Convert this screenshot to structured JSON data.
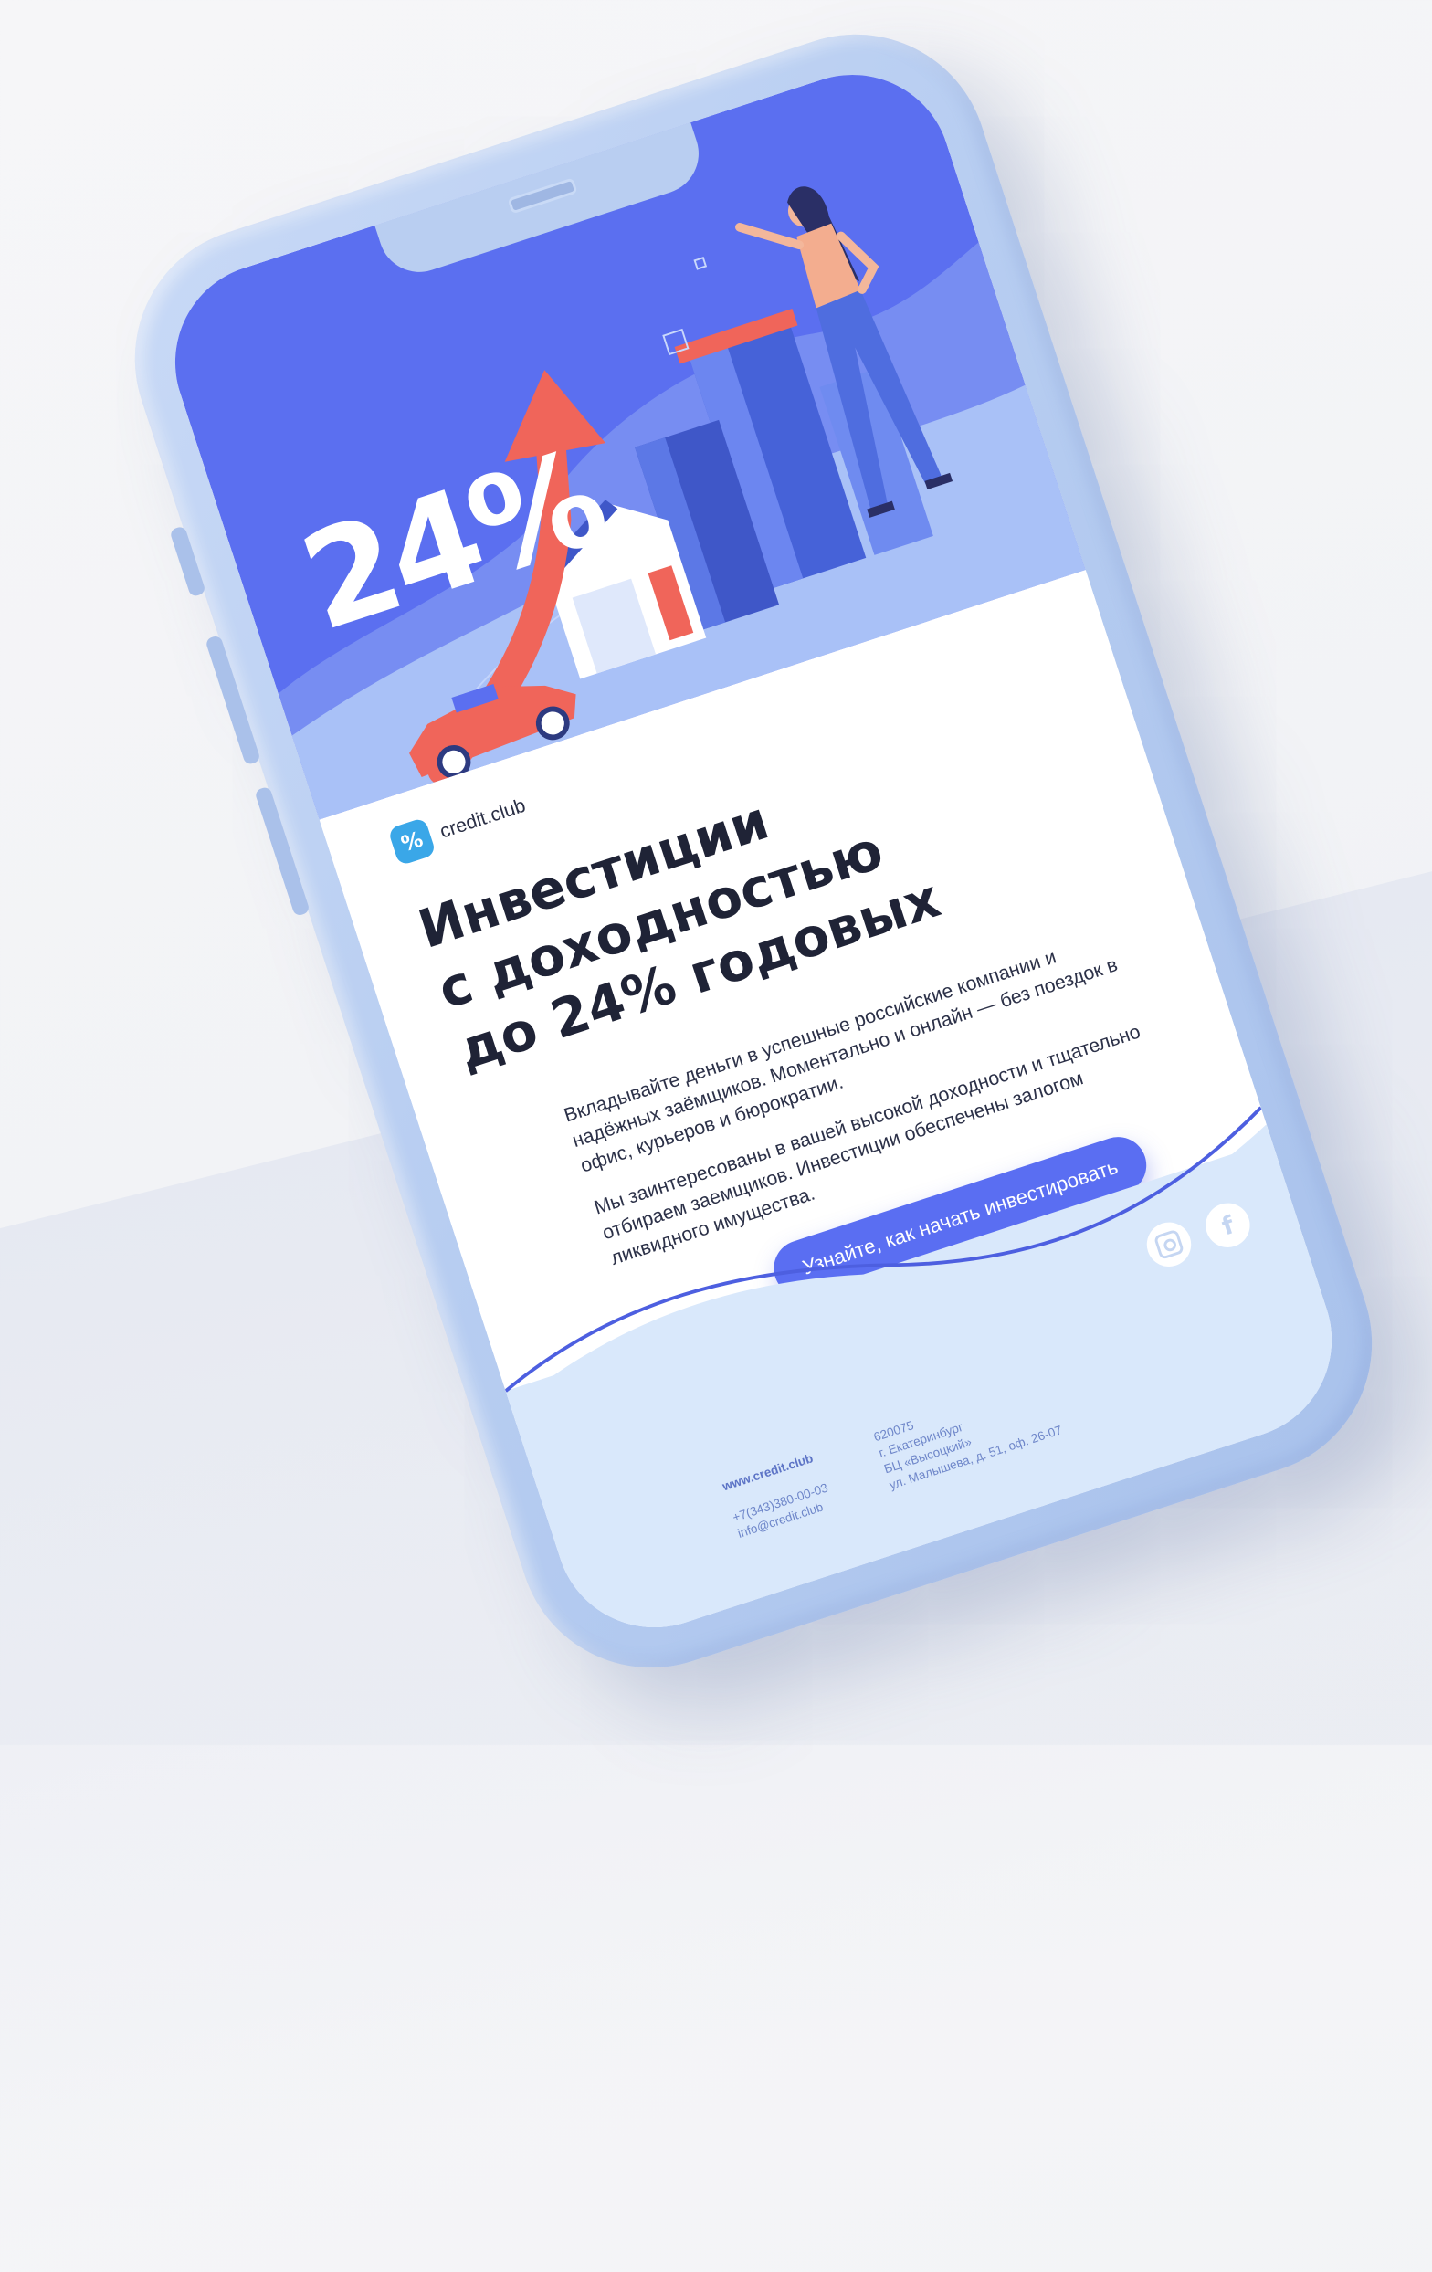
{
  "hero": {
    "percent": "24%"
  },
  "logo": {
    "mark": "%",
    "name": "credit.club"
  },
  "headline": [
    "Инвестиции",
    "с доходностью",
    "до 24% годовых"
  ],
  "paragraphs": [
    "Вкладывайте деньги в успешные российские компании и надёжных заёмщиков. Моментально и онлайн — без поездок в офис, курьеров и бюрократии.",
    "Мы заинтересованы в вашей высокой доходности и тщательно отбираем заемщиков. Инвестиции обеспечены залогом ликвидного имущества."
  ],
  "cta": {
    "label": "Узнайте, как начать инвестировать"
  },
  "footer": {
    "social": [
      "instagram-icon",
      "facebook-icon"
    ],
    "facebook_glyph": "f",
    "website": "www.credit.club",
    "phone": "+7(343)380-00-03",
    "email": "info@credit.club",
    "address": [
      "620075",
      "г. Екатеринбург",
      "БЦ «Высоцкий»",
      "ул. Малышева, д. 51, оф. 26-07"
    ]
  },
  "colors": {
    "brand_blue": "#5b6ff0",
    "accent_red": "#f0655a",
    "phone_body": "#b7cdf1",
    "footer_bg": "#d9e8fb"
  }
}
